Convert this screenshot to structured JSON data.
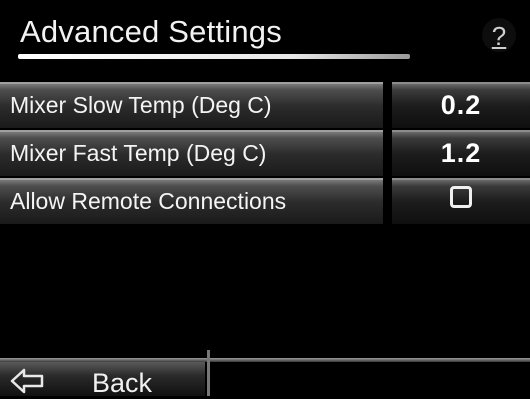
{
  "header": {
    "title": "Advanced Settings",
    "help_glyph": "?"
  },
  "settings": [
    {
      "label": "Mixer Slow Temp (Deg C)",
      "value": "0.2",
      "type": "number"
    },
    {
      "label": "Mixer Fast Temp (Deg C)",
      "value": "1.2",
      "type": "number"
    },
    {
      "label": "Allow Remote Connections",
      "value": "",
      "type": "checkbox",
      "checked": false
    }
  ],
  "footer": {
    "back_label": "Back",
    "back_icon": "back-arrow-icon"
  }
}
